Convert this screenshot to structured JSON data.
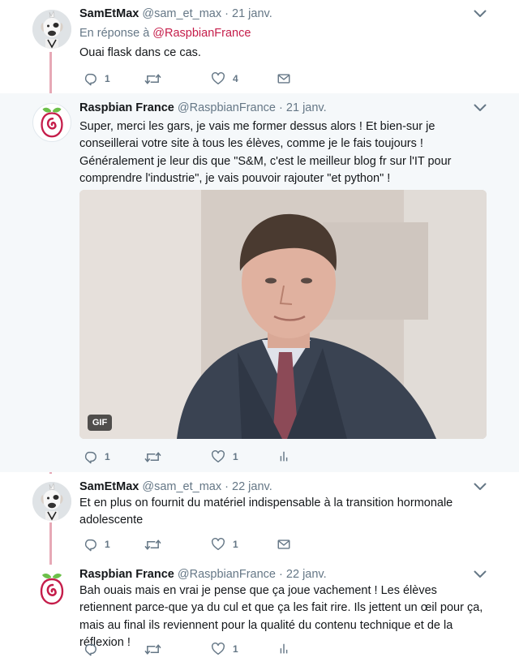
{
  "tweets": [
    {
      "name": "SamEtMax",
      "handle": "@sam_et_max",
      "date": "21 janv.",
      "reply_prefix": "En réponse à",
      "reply_to": "@RaspbianFrance",
      "text": "Ouai flask dans ce cas.",
      "reply_count": "1",
      "retweet_count": "",
      "like_count": "4",
      "extra_action": "envelope-icon"
    },
    {
      "name": "Raspbian France",
      "handle": "@RaspbianFrance",
      "date": "21 janv.",
      "text": "Super, merci les gars, je vais me former dessus alors ! Et bien-sur je conseillerai votre site à tous les élèves, comme je le fais toujours ! Généralement je leur dis que \"S&M, c'est le meilleur blog fr sur l'IT pour comprendre l'industrie\", je vais pouvoir rajouter \"et python\" !",
      "media_badge": "GIF",
      "reply_count": "1",
      "retweet_count": "",
      "like_count": "1",
      "extra_action": "analytics-icon"
    },
    {
      "name": "SamEtMax",
      "handle": "@sam_et_max",
      "date": "22 janv.",
      "text": "Et en plus on fournit du matériel indispensable à la transition hormonale adolescente",
      "reply_count": "1",
      "retweet_count": "",
      "like_count": "1",
      "extra_action": "envelope-icon"
    },
    {
      "name": "Raspbian France",
      "handle": "@RaspbianFrance",
      "date": "22 janv.",
      "text": "Bah ouais mais en vrai je pense que ça joue vachement ! Les élèves retiennent parce-que ya du cul et que ça les fait rire. Ils jettent un œil pour ça, mais au final ils reviennent pour la qualité du contenu technique et de la réflexion !",
      "reply_count": "",
      "retweet_count": "",
      "like_count": "1",
      "extra_action": "analytics-icon"
    }
  ],
  "colors": {
    "accent": "#c51d4a",
    "thread_line": "#e7a9b6",
    "muted": "#657786",
    "highlight_bg": "#f5f8fa"
  }
}
